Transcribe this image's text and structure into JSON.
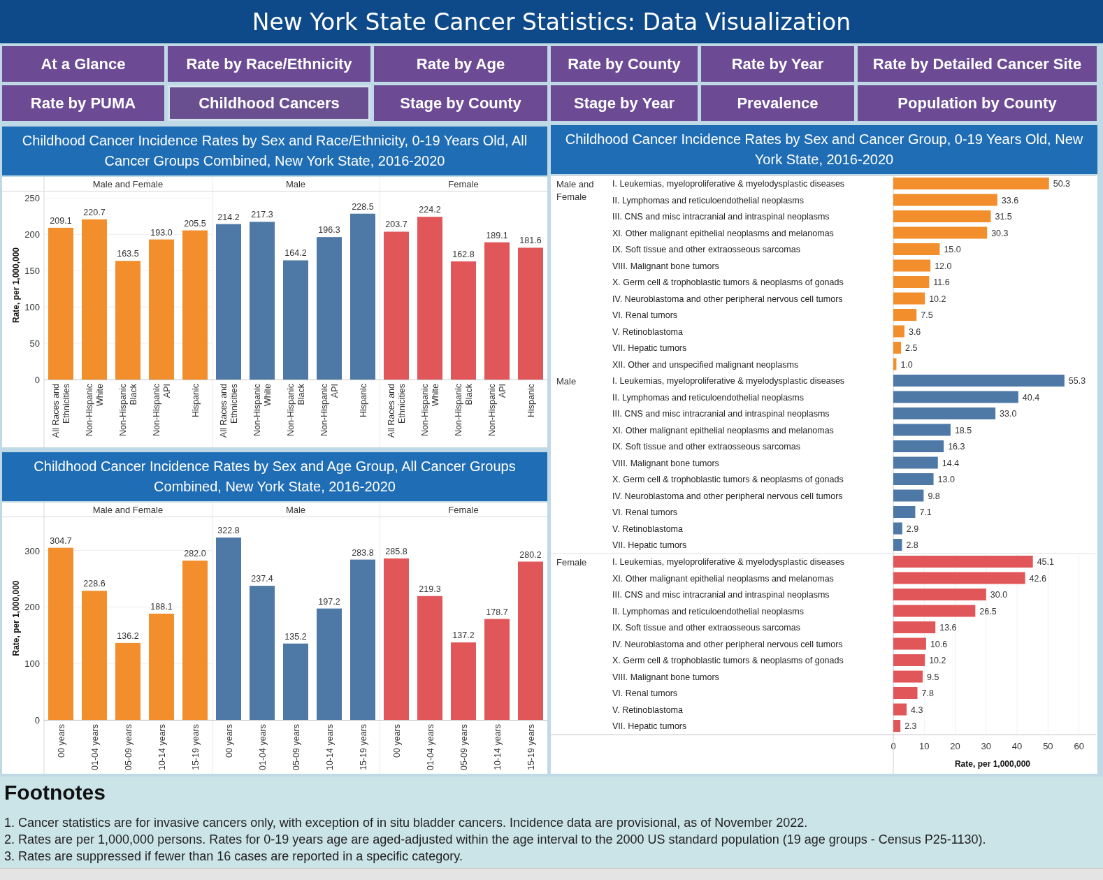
{
  "title": "New York State Cancer Statistics: Data Visualization",
  "nav": [
    {
      "label": "At a Glance",
      "selected": false
    },
    {
      "label": "Rate by Race/Ethnicity",
      "selected": false
    },
    {
      "label": "Rate by Age",
      "selected": false
    },
    {
      "label": "Rate by County",
      "selected": false
    },
    {
      "label": "Rate by Year",
      "selected": false
    },
    {
      "label": "Rate by Detailed Cancer Site",
      "selected": false
    },
    {
      "label": "Rate by PUMA",
      "selected": false
    },
    {
      "label": "Childhood Cancers",
      "selected": true
    },
    {
      "label": "Stage by County",
      "selected": false
    },
    {
      "label": "Stage by Year",
      "selected": false
    },
    {
      "label": "Prevalence",
      "selected": false
    },
    {
      "label": "Population by County",
      "selected": false
    }
  ],
  "race_section": {
    "title": "Childhood Cancer Incidence Rates by Sex and Race/Ethnicity, 0-19 Years Old, All Cancer Groups Combined, New York State, 2016-2020",
    "panels": [
      {
        "chart_data": {
          "type": "bar",
          "ylabel": "Rate, per 1,000,000",
          "categories": [
            "All Races and Ethnicities",
            "Non-Hispanic White",
            "Non-Hispanic Black",
            "Non-Hispanic API",
            "Hispanic"
          ],
          "series": [
            {
              "name": "Male and Female",
              "color": "#f28e2b",
              "values": [
                209.1,
                220.7,
                163.5,
                193.0,
                205.5
              ]
            }
          ],
          "ylim": [
            0,
            260
          ],
          "yticks": [
            0,
            50,
            100,
            150,
            200,
            250
          ],
          "grid": true,
          "value_labels": [
            "209.1",
            "220.7",
            "163.5",
            "193.0",
            "205.5"
          ]
        }
      },
      {
        "chart_data": {
          "type": "bar",
          "categories": [
            "All Races and Ethnicities",
            "Non-Hispanic White",
            "Non-Hispanic Black",
            "Non-Hispanic API",
            "Hispanic"
          ],
          "series": [
            {
              "name": "Male",
              "color": "#4e79a7",
              "values": [
                214.2,
                217.3,
                164.2,
                196.3,
                228.5
              ]
            }
          ],
          "ylim": [
            0,
            260
          ],
          "value_labels": [
            "214.2",
            "217.3",
            "164.2",
            "196.3",
            "228.5"
          ]
        }
      },
      {
        "chart_data": {
          "type": "bar",
          "categories": [
            "All Races and Ethnicities",
            "Non-Hispanic White",
            "Non-Hispanic Black",
            "Non-Hispanic API",
            "Hispanic"
          ],
          "series": [
            {
              "name": "Female",
              "color": "#e15759",
              "values": [
                203.7,
                224.2,
                162.8,
                189.1,
                181.6
              ]
            }
          ],
          "ylim": [
            0,
            260
          ],
          "value_labels": [
            "203.7",
            "224.2",
            "162.8",
            "189.1",
            "181.6"
          ]
        }
      }
    ]
  },
  "age_section": {
    "title": "Childhood Cancer Incidence Rates by Sex and Age Group, All Cancer Groups Combined, New York State, 2016-2020",
    "panels": [
      {
        "chart_data": {
          "type": "bar",
          "ylabel": "Rate, per 1,000,000",
          "categories": [
            "00 years",
            "01-04 years",
            "05-09 years",
            "10-14 years",
            "15-19 years"
          ],
          "series": [
            {
              "name": "Male and Female",
              "color": "#f28e2b",
              "values": [
                304.7,
                228.6,
                136.2,
                188.1,
                282.0
              ]
            }
          ],
          "ylim": [
            0,
            360
          ],
          "yticks": [
            0,
            100,
            200,
            300
          ],
          "grid": true,
          "value_labels": [
            "304.7",
            "228.6",
            "136.2",
            "188.1",
            "282.0"
          ]
        }
      },
      {
        "chart_data": {
          "type": "bar",
          "categories": [
            "00 years",
            "01-04 years",
            "05-09 years",
            "10-14 years",
            "15-19 years"
          ],
          "series": [
            {
              "name": "Male",
              "color": "#4e79a7",
              "values": [
                322.8,
                237.4,
                135.2,
                197.2,
                283.8
              ]
            }
          ],
          "ylim": [
            0,
            360
          ],
          "value_labels": [
            "322.8",
            "237.4",
            "135.2",
            "197.2",
            "283.8"
          ]
        }
      },
      {
        "chart_data": {
          "type": "bar",
          "categories": [
            "00 years",
            "01-04 years",
            "05-09 years",
            "10-14 years",
            "15-19 years"
          ],
          "series": [
            {
              "name": "Female",
              "color": "#e15759",
              "values": [
                285.8,
                219.3,
                137.2,
                178.7,
                280.2
              ]
            }
          ],
          "ylim": [
            0,
            360
          ],
          "value_labels": [
            "285.8",
            "219.3",
            "137.2",
            "178.7",
            "280.2"
          ]
        }
      }
    ]
  },
  "group_section": {
    "title": "Childhood Cancer Incidence Rates by Sex and Cancer Group, 0-19 Years Old, New York State, 2016-2020",
    "panels": [
      {
        "chart_data": {
          "type": "bar",
          "orientation": "horizontal",
          "categories": [
            "I. Leukemias, myeloproliferative & myelodysplastic diseases",
            "II. Lymphomas and reticuloendothelial neoplasms",
            "III. CNS and misc intracranial and intraspinal neoplasms",
            "XI. Other malignant epithelial neoplasms and melanomas",
            "IX. Soft tissue and other extraosseous sarcomas",
            "VIII. Malignant bone tumors",
            "X. Germ cell & trophoblastic tumors & neoplasms of gonads",
            "IV. Neuroblastoma and other peripheral nervous cell tumors",
            "VI. Renal tumors",
            "V. Retinoblastoma",
            "VII. Hepatic tumors",
            "XII. Other and unspecified malignant neoplasms"
          ],
          "xlim": [
            0,
            65.5
          ],
          "series": [
            {
              "name": "Male and Female",
              "color": "#f28e2b",
              "values": [
                50.3,
                33.6,
                31.5,
                30.3,
                15.0,
                12.0,
                11.6,
                10.2,
                7.5,
                3.6,
                2.5,
                1.0
              ]
            }
          ],
          "value_labels": [
            "50.3",
            "33.6",
            "31.5",
            "30.3",
            "15.0",
            "12.0",
            "11.6",
            "10.2",
            "7.5",
            "3.6",
            "2.5",
            "1.0"
          ]
        }
      },
      {
        "chart_data": {
          "type": "bar",
          "orientation": "horizontal",
          "categories": [
            "I. Leukemias, myeloproliferative & myelodysplastic diseases",
            "II. Lymphomas and reticuloendothelial neoplasms",
            "III. CNS and misc intracranial and intraspinal neoplasms",
            "XI. Other malignant epithelial neoplasms and melanomas",
            "IX. Soft tissue and other extraosseous sarcomas",
            "VIII. Malignant bone tumors",
            "X. Germ cell & trophoblastic tumors & neoplasms of gonads",
            "IV. Neuroblastoma and other peripheral nervous cell tumors",
            "VI. Renal tumors",
            "V. Retinoblastoma",
            "VII. Hepatic tumors"
          ],
          "xlim": [
            0,
            65.5
          ],
          "series": [
            {
              "name": "Male",
              "color": "#4e79a7",
              "values": [
                55.3,
                40.4,
                33.0,
                18.5,
                16.3,
                14.4,
                13.0,
                9.8,
                7.1,
                2.9,
                2.8
              ]
            }
          ],
          "value_labels": [
            "55.3",
            "40.4",
            "33.0",
            "18.5",
            "16.3",
            "14.4",
            "13.0",
            "9.8",
            "7.1",
            "2.9",
            "2.8"
          ]
        }
      },
      {
        "chart_data": {
          "type": "bar",
          "orientation": "horizontal",
          "xlabel": "Rate, per 1,000,000",
          "categories": [
            "I. Leukemias, myeloproliferative & myelodysplastic diseases",
            "XI. Other malignant epithelial neoplasms and melanomas",
            "III. CNS and misc intracranial and intraspinal neoplasms",
            "II. Lymphomas and reticuloendothelial neoplasms",
            "IX. Soft tissue and other extraosseous sarcomas",
            "IV. Neuroblastoma and other peripheral nervous cell tumors",
            "X. Germ cell & trophoblastic tumors & neoplasms of gonads",
            "VIII. Malignant bone tumors",
            "VI. Renal tumors",
            "V. Retinoblastoma",
            "VII. Hepatic tumors"
          ],
          "series": [
            {
              "name": "Female",
              "color": "#e15759",
              "values": [
                45.1,
                42.6,
                30.0,
                26.5,
                13.6,
                10.6,
                10.2,
                9.5,
                7.8,
                4.3,
                2.3
              ]
            }
          ],
          "xlim": [
            0,
            65.5
          ],
          "xticks": [
            0,
            10,
            20,
            30,
            40,
            50,
            60
          ],
          "grid": true,
          "value_labels": [
            "45.1",
            "42.6",
            "30.0",
            "26.5",
            "13.6",
            "10.6",
            "10.2",
            "9.5",
            "7.8",
            "4.3",
            "2.3"
          ]
        }
      }
    ]
  },
  "footnotes": {
    "heading": "Footnotes",
    "lines": [
      "1. Cancer statistics are for invasive cancers only, with exception of in situ bladder cancers. Incidence data are provisional, as of November 2022.",
      "2. Rates are per 1,000,000 persons. Rates for 0-19 years age are aged-adjusted within the age interval to the 2000 US standard population (19 age groups - Census P25-1130).",
      "3. Rates are suppressed if fewer than 16 cases are reported in a specific category."
    ]
  }
}
